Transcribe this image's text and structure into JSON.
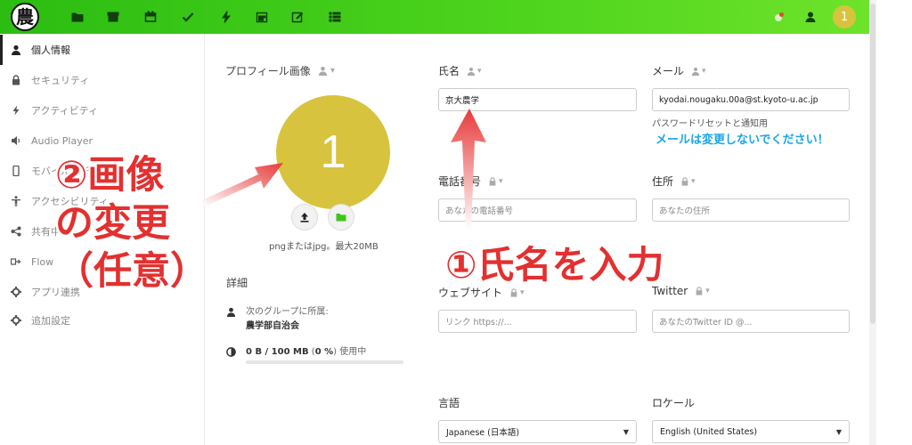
{
  "header": {
    "logo_char": "農",
    "nav_icons": [
      "folder-icon",
      "archive-icon",
      "calendar-icon",
      "check-icon",
      "lightning-icon",
      "calendar-grid-icon",
      "edit-icon",
      "list-icon"
    ],
    "avatar_initial": "1",
    "brand_color": "#3ec71a"
  },
  "sidebar": {
    "items": [
      {
        "label": "個人情報",
        "icon": "person-icon"
      },
      {
        "label": "セキュリティ",
        "icon": "lock-icon"
      },
      {
        "label": "アクティビティ",
        "icon": "lightning-icon"
      },
      {
        "label": "Audio Player",
        "icon": "speaker-icon"
      },
      {
        "label": "モバイルとデスクトップ",
        "icon": "phone-icon"
      },
      {
        "label": "アクセシビリティ",
        "icon": "accessibility-icon"
      },
      {
        "label": "共有中",
        "icon": "share-icon"
      },
      {
        "label": "Flow",
        "icon": "flow-icon"
      },
      {
        "label": "アプリ連携",
        "icon": "gear-icon"
      },
      {
        "label": "追加設定",
        "icon": "gear-icon"
      }
    ]
  },
  "profile": {
    "title": "プロフィール画像",
    "avatar_initial": "1",
    "avatar_color": "#d8c33e",
    "hint": "pngまたはjpg。最大20MB",
    "details_title": "詳細",
    "group_label": "次のグループに所属:",
    "group_name": "農学部自治会",
    "usage_bold": "0 B / 100 MB",
    "usage_pct": "0 %",
    "usage_text": "使用中",
    "usage_fraction": 0
  },
  "fields": {
    "name": {
      "label": "氏名",
      "value": "京大農学"
    },
    "email": {
      "label": "メール",
      "value": "kyodai.nougaku.00a@st.kyoto-u.ac.jp",
      "note": "パスワードリセットと通知用"
    },
    "email_warning": "メールは変更しないでください！",
    "phone": {
      "label": "電話番号",
      "placeholder": "あなたの電話番号"
    },
    "address": {
      "label": "住所",
      "placeholder": "あなたの住所"
    },
    "website": {
      "label": "ウェブサイト",
      "placeholder": "リンク https://..."
    },
    "twitter": {
      "label": "Twitter",
      "placeholder": "あなたのTwitter ID @..."
    },
    "language": {
      "label": "言語",
      "value": "Japanese (日本語)"
    },
    "locale": {
      "label": "ロケール",
      "value": "English (United States)"
    }
  },
  "annotations": {
    "step1": "①氏名を入力",
    "step2_line1": "②画像",
    "step2_line2": "の変更",
    "step2_line3": "（任意）",
    "color": "#e33030"
  }
}
